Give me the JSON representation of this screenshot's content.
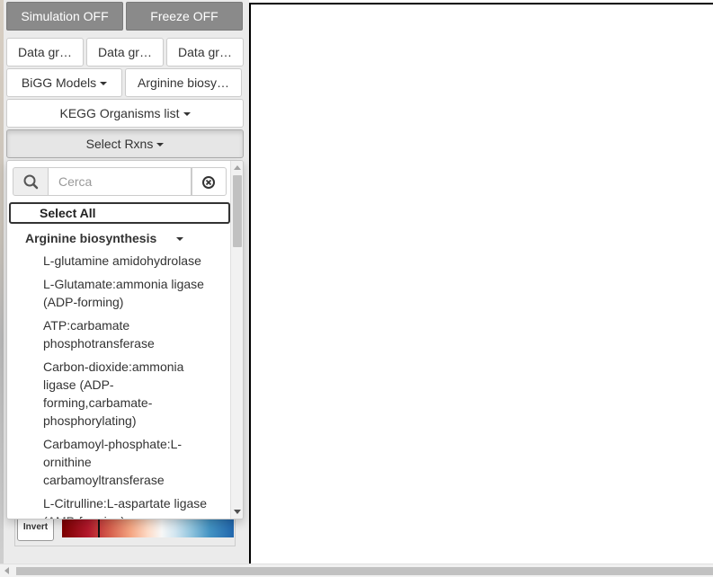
{
  "toolbar": {
    "simulation_label": "Simulation OFF",
    "freeze_label": "Freeze OFF"
  },
  "data_groups": [
    "Data gr…",
    "Data gr…",
    "Data gr…"
  ],
  "bigg_models_label": "BiGG Models",
  "pathway_label": "Arginine biosy…",
  "kegg_label": "KEGG Organisms list",
  "select_rxns_label": "Select Rxns",
  "dropdown": {
    "search_placeholder": "Cerca",
    "select_all_label": "Select All",
    "group_label": "Arginine biosynthesis",
    "reactions": [
      "L-glutamine amidohydrolase",
      "L-Glutamate:ammonia ligase (ADP-forming)",
      "ATP:carbamate phosphotransferase",
      "Carbon-dioxide:ammonia ligase (ADP-forming,carbamate-phosphorylating)",
      "Carbamoyl-phosphate:L-ornithine carbamoyltransferase",
      "L-Citrulline:L-aspartate ligase (AMP-forming)"
    ]
  },
  "legend": {
    "invert_label": "Invert",
    "colors": [
      "#7a0000",
      "#b2182b",
      "#f4a582",
      "#f7f7f7",
      "#92c5de",
      "#2166ac"
    ]
  },
  "icons": {
    "search": "search-icon",
    "clear": "clear-circle-x-icon"
  }
}
